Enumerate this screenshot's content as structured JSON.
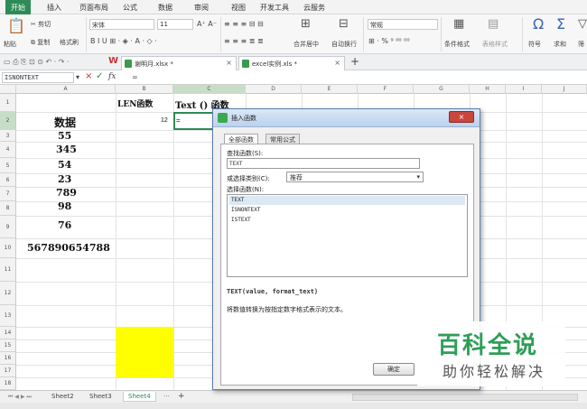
{
  "menu": [
    "开始",
    "插入",
    "页面布局",
    "公式",
    "数据",
    "审阅",
    "视图",
    "开发工具",
    "云服务"
  ],
  "ribbon": {
    "cut": "剪切",
    "copy": "复制",
    "format_painter": "格式刷",
    "paste": "粘贴",
    "font_name": "宋体",
    "font_size": "11",
    "merge_center": "合并居中",
    "wrap_text": "自动换行",
    "number_format": "常规",
    "cond_format": "条件格式",
    "table_style": "表格样式",
    "symbol": "符号",
    "sum": "求和",
    "filter": "筛"
  },
  "doc_tabs": [
    {
      "name": "谢明月.xlsx *"
    },
    {
      "name": "excel实例.xls *"
    }
  ],
  "formula_bar": {
    "name_box": "ISNONTEXT",
    "cancel": "×",
    "confirm": "✓",
    "fx": "fx",
    "formula": "="
  },
  "columns": [
    "A",
    "B",
    "C",
    "D",
    "E",
    "F",
    "G",
    "H",
    "I",
    "J"
  ],
  "rows": [
    "1",
    "2",
    "3",
    "4",
    "5",
    "6",
    "7",
    "8",
    "9",
    "10",
    "11",
    "12",
    "13",
    "14",
    "15",
    "16",
    "17",
    "18"
  ],
  "cells": {
    "b1": "LEN函数",
    "c1": "Text () 函数",
    "a2": "数据",
    "b2": "12",
    "c2": "=",
    "a3": "55",
    "a4": "345",
    "a5": "54",
    "a6": "23",
    "a7": "789",
    "a8": "98",
    "a9": "76",
    "a10": "567890654788"
  },
  "highlight_color": "#ffff00",
  "sheets": [
    "Sheet2",
    "Sheet3",
    "Sheet4"
  ],
  "dialog": {
    "title": "插入函数",
    "close": "×",
    "tabs": [
      "全部函数",
      "常用公式"
    ],
    "search_label": "查找函数(S):",
    "search_value": "TEXT",
    "category_label": "或选择类别(C):",
    "category_value": "推荐",
    "select_label": "选择函数(N):",
    "functions": [
      "TEXT",
      "ISNONTEXT",
      "ISTEXT"
    ],
    "signature": "TEXT(value, format_text)",
    "description": "将数值转换为按指定数字格式表示的文本。",
    "ok": "确定"
  },
  "watermark": {
    "title": "百科全说",
    "subtitle": "助你轻松解决"
  }
}
